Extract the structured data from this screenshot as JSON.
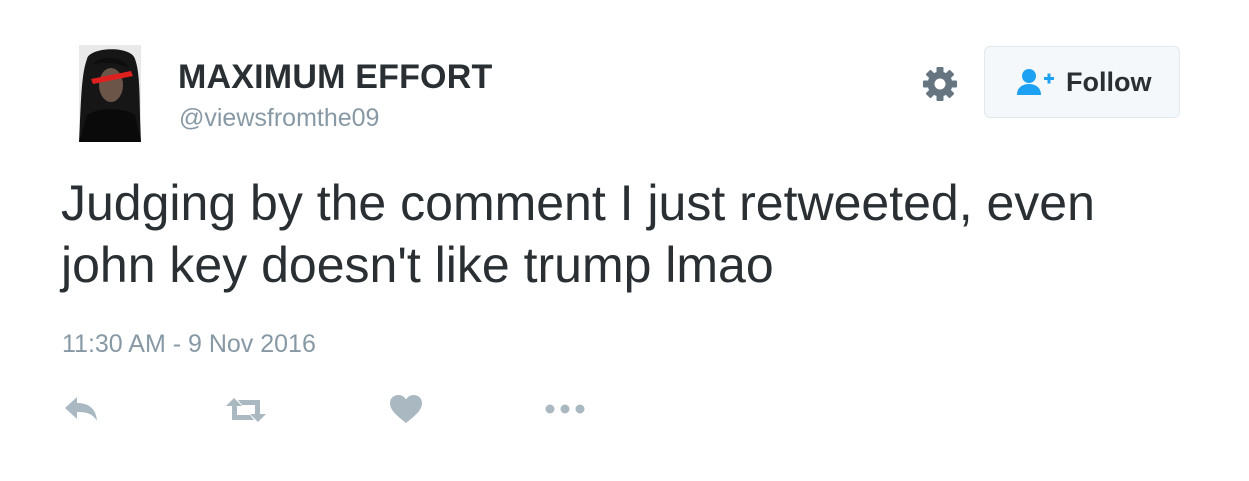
{
  "user": {
    "display_name": "MAXIMUM EFFORT",
    "handle": "@viewsfromthe09"
  },
  "follow_button": {
    "label": "Follow",
    "icon": "follow-user-icon"
  },
  "settings": {
    "icon": "gear-icon"
  },
  "tweet": {
    "text": "Judging by the comment I just retweeted, even john key doesn't like trump lmao",
    "timestamp": "11:30 AM - 9 Nov 2016"
  },
  "actions": [
    {
      "name": "reply",
      "icon": "reply-icon"
    },
    {
      "name": "retweet",
      "icon": "retweet-icon"
    },
    {
      "name": "like",
      "icon": "heart-icon"
    },
    {
      "name": "more",
      "icon": "more-dots-icon"
    }
  ],
  "colors": {
    "text": "#292f33",
    "secondary": "#8899a6",
    "icon_gray": "#aab8c2",
    "follow_blue": "#1da1f2",
    "button_bg": "#f5f8fa",
    "button_border": "#e1e8ed"
  }
}
